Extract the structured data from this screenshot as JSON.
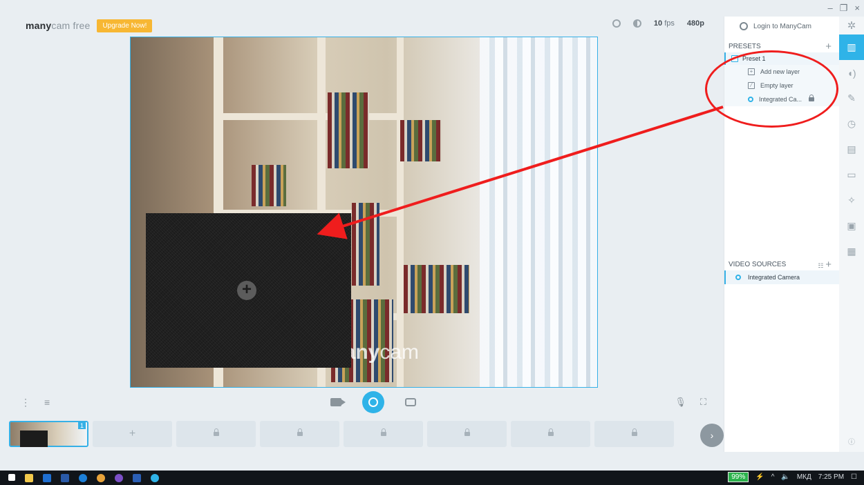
{
  "app": {
    "logo_bold": "many",
    "logo_light": "cam free",
    "upgrade_label": "Upgrade Now!"
  },
  "topbar": {
    "fps_value": "10",
    "fps_unit": "fps",
    "resolution": "480p",
    "login_label": "Login to ManyCam"
  },
  "preview": {
    "watermark_bold": "many",
    "watermark_light": "cam",
    "empty_layer_plus": "+"
  },
  "presets": {
    "title": "PRESETS",
    "preset_name": "Preset 1",
    "layers": [
      {
        "label": "Add new layer",
        "icon": "add-layer-icon"
      },
      {
        "label": "Empty layer",
        "icon": "empty-layer-icon"
      },
      {
        "label": "Integrated Ca...",
        "icon": "camera-pin-icon",
        "locked": true
      }
    ]
  },
  "video_sources": {
    "title": "VIDEO SOURCES",
    "items": [
      {
        "label": "Integrated Camera"
      }
    ]
  },
  "thumbnails": {
    "active_number": "1",
    "add_symbol": "+",
    "next_symbol": "›"
  },
  "taskbar": {
    "battery": "99%",
    "language": "МКД",
    "time": "7:25 PM"
  },
  "window_controls": {
    "minimize": "–",
    "restore": "❐",
    "close": "×"
  },
  "colors": {
    "accent": "#2fb3e8",
    "upgrade": "#f7b733",
    "annotation": "#ef1d1d"
  }
}
